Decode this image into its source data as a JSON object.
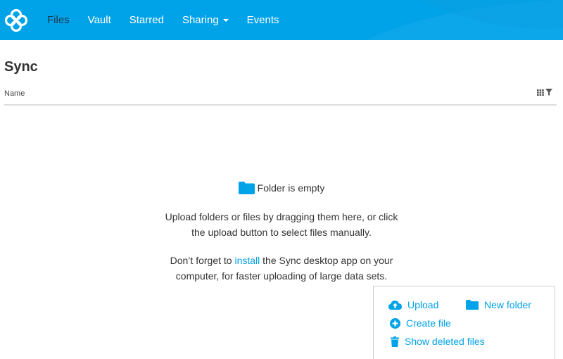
{
  "nav": {
    "items": [
      {
        "label": "Files",
        "active": true
      },
      {
        "label": "Vault"
      },
      {
        "label": "Starred"
      },
      {
        "label": "Sharing"
      },
      {
        "label": "Events"
      }
    ],
    "accent_color": "#00a2e8"
  },
  "page": {
    "title": "Sync"
  },
  "table": {
    "column_name": "Name",
    "tools": [
      "grid-view-icon",
      "filter-icon"
    ]
  },
  "empty_state": {
    "title": "Folder is empty",
    "line1": "Upload folders or files by dragging them here, or click",
    "line2": "the upload button to select files manually.",
    "line3_prefix": "Don’t forget to ",
    "line3_link": "install",
    "line3_suffix": " the Sync desktop app on your",
    "line4": "computer, for faster uploading of large data sets."
  },
  "actions": {
    "upload": "Upload",
    "new_folder": "New folder",
    "create_file": "Create file",
    "show_deleted": "Show deleted files"
  }
}
